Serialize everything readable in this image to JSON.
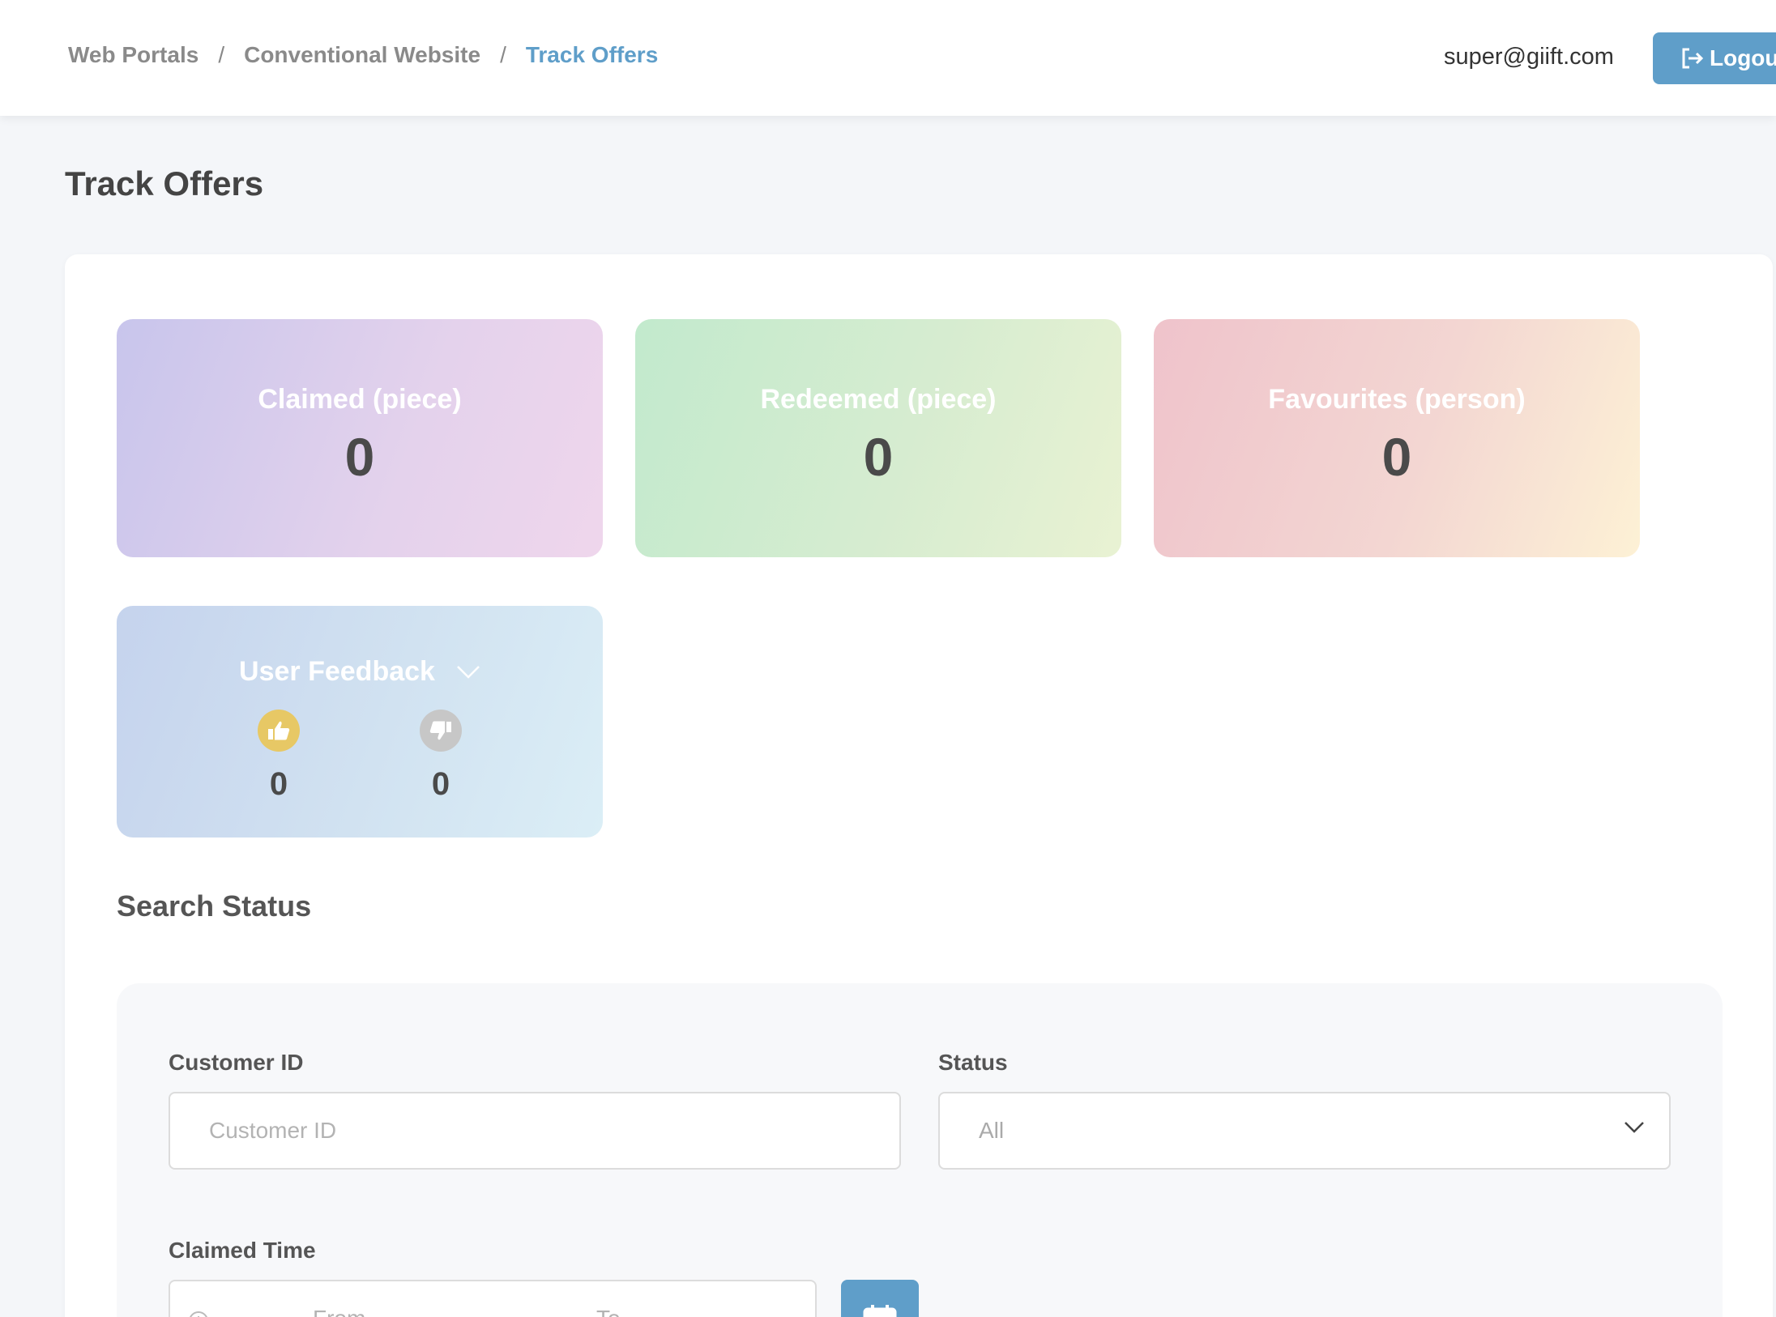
{
  "breadcrumb": {
    "items": [
      "Web Portals",
      "Conventional Website",
      "Track Offers"
    ],
    "separator": "/"
  },
  "header": {
    "user_email": "super@giift.com",
    "logout_label": "Logou"
  },
  "page": {
    "title": "Track Offers"
  },
  "stats": {
    "claimed": {
      "label": "Claimed (piece)",
      "value": "0"
    },
    "redeemed": {
      "label": "Redeemed (piece)",
      "value": "0"
    },
    "favourites": {
      "label": "Favourites (person)",
      "value": "0"
    }
  },
  "feedback": {
    "label": "User Feedback",
    "likes": "0",
    "dislikes": "0"
  },
  "search": {
    "title": "Search Status",
    "customer_id_label": "Customer ID",
    "customer_id_placeholder": "Customer ID",
    "status_label": "Status",
    "status_value": "All",
    "claimed_time_label": "Claimed Time",
    "from_placeholder": "From",
    "to_placeholder": "To"
  },
  "colors": {
    "accent": "#5f9ec9",
    "like": "#e7c865",
    "dislike": "#c7c7c7"
  },
  "icons": [
    "logout-icon",
    "chevron-down-icon",
    "thumbs-up-icon",
    "thumbs-down-icon",
    "clock-icon",
    "calendar-icon"
  ]
}
